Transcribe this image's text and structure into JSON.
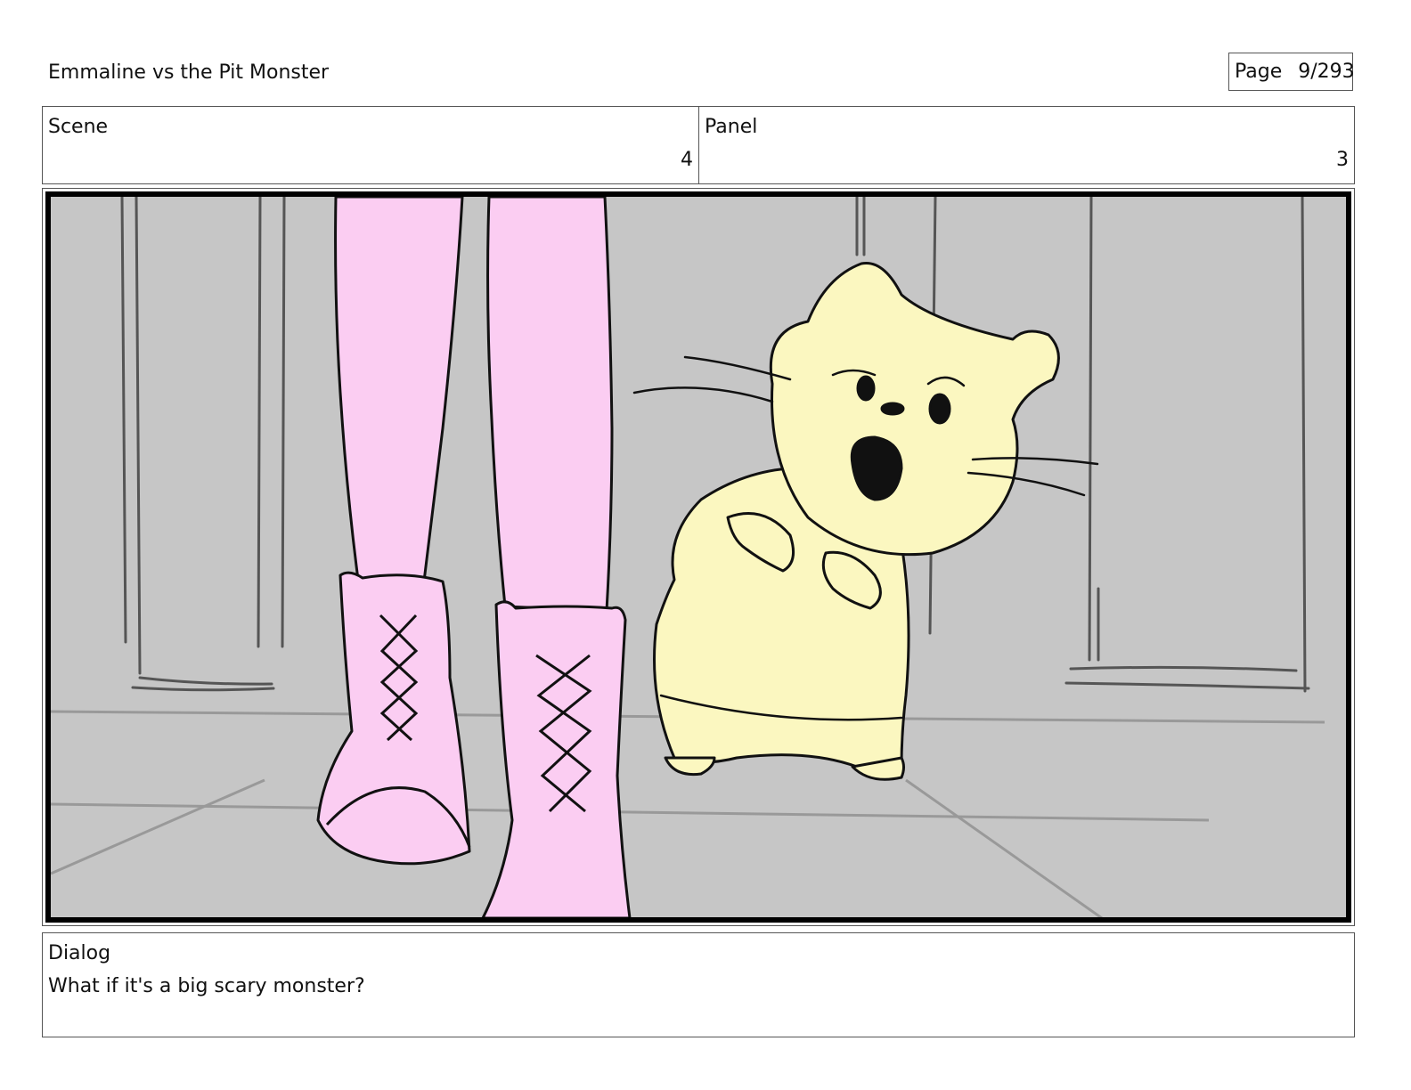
{
  "header": {
    "title": "Emmaline vs the Pit Monster",
    "page_label": "Page",
    "page_number": "9/293"
  },
  "info": {
    "scene_label": "Scene",
    "scene_value": "4",
    "panel_label": "Panel",
    "panel_value": "3"
  },
  "frame": {
    "background_color": "#c6c6c6",
    "legs_color": "#fbcdf2",
    "hamster_color": "#fbf7c0",
    "ink_color": "#111111"
  },
  "dialog": {
    "label": "Dialog",
    "text": "What if it's a big scary monster?"
  }
}
